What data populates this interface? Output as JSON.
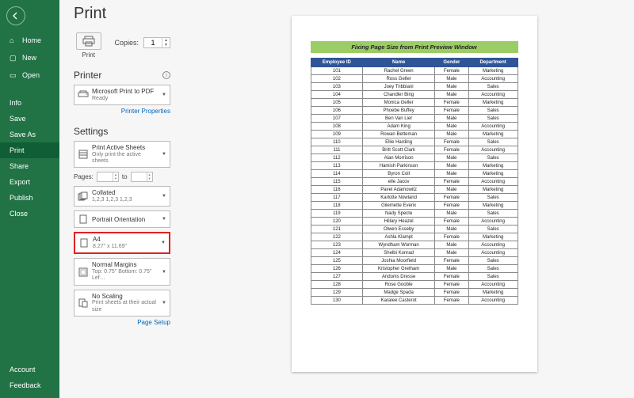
{
  "sidebar": {
    "items": [
      "Home",
      "New",
      "Open"
    ],
    "menu": [
      "Info",
      "Save",
      "Save As",
      "Print",
      "Share",
      "Export",
      "Publish",
      "Close"
    ],
    "selected": "Print",
    "footer": [
      "Account",
      "Feedback"
    ]
  },
  "header": {
    "title": "Print"
  },
  "print_button": {
    "label": "Print"
  },
  "copies": {
    "label": "Copies:",
    "value": "1"
  },
  "printer_section": {
    "title": "Printer"
  },
  "printer_combo": {
    "name": "Microsoft Print to PDF",
    "status": "Ready"
  },
  "printer_props_link": "Printer Properties",
  "settings_section": {
    "title": "Settings"
  },
  "sheets_combo": {
    "title": "Print Active Sheets",
    "sub": "Only print the active sheets"
  },
  "pages": {
    "label": "Pages:",
    "to": "to",
    "from": "",
    "end": ""
  },
  "collate_combo": {
    "title": "Collated",
    "sub": "1,2,3   1,2,3   1,2,3"
  },
  "orient_combo": {
    "title": "Portrait Orientation",
    "sub": ""
  },
  "size_combo": {
    "title": "A4",
    "sub": "8.27\" x 11.69\""
  },
  "margins_combo": {
    "title": "Normal Margins",
    "sub": "Top: 0.75\" Bottom: 0.75\" Lef…"
  },
  "scaling_combo": {
    "title": "No Scaling",
    "sub": "Print sheets at their actual size"
  },
  "page_setup_link": "Page Setup",
  "doc": {
    "title": "Fixing Page Size from Print Preview Window",
    "headers": [
      "Employee ID",
      "Name",
      "Gender",
      "Department"
    ]
  },
  "chart_data": {
    "type": "table",
    "columns": [
      "Employee ID",
      "Name",
      "Gender",
      "Department"
    ],
    "rows": [
      [
        "101",
        "Rachel Green",
        "Female",
        "Marketing"
      ],
      [
        "102",
        "Ross Geller",
        "Male",
        "Accounting"
      ],
      [
        "103",
        "Joey Tribbiani",
        "Male",
        "Sales"
      ],
      [
        "104",
        "Chandler Bing",
        "Male",
        "Accounting"
      ],
      [
        "105",
        "Monica Geller",
        "Female",
        "Marketing"
      ],
      [
        "106",
        "Phoebe Buffey",
        "Female",
        "Sales"
      ],
      [
        "107",
        "Ben Van Lier",
        "Male",
        "Sales"
      ],
      [
        "108",
        "Adam King",
        "Male",
        "Accounting"
      ],
      [
        "109",
        "Rowan Betteman",
        "Male",
        "Marketing"
      ],
      [
        "110",
        "Ellie Harding",
        "Female",
        "Sales"
      ],
      [
        "111",
        "Britt Scott Clark",
        "Female",
        "Accounting"
      ],
      [
        "112",
        "Alan Morrison",
        "Male",
        "Sales"
      ],
      [
        "113",
        "Hamish Parkinson",
        "Male",
        "Marketing"
      ],
      [
        "114",
        "Byron Coll",
        "Male",
        "Marketing"
      ],
      [
        "115",
        "elle Jacov",
        "Female",
        "Accounting"
      ],
      [
        "116",
        "Pavel Adamowitz",
        "Male",
        "Marketing"
      ],
      [
        "117",
        "Karlotte Nowland",
        "Female",
        "Sales"
      ],
      [
        "118",
        "Gilemette Everix",
        "Female",
        "Marketing"
      ],
      [
        "119",
        "Nady Specte",
        "Male",
        "Sales"
      ],
      [
        "120",
        "Hillary Heazel",
        "Female",
        "Accounting"
      ],
      [
        "121",
        "Olwen Esseby",
        "Male",
        "Sales"
      ],
      [
        "122",
        "Ashla Klampt",
        "Female",
        "Marketing"
      ],
      [
        "123",
        "Wyndham Worman",
        "Male",
        "Accounting"
      ],
      [
        "124",
        "Shelbi Konrad",
        "Male",
        "Accounting"
      ],
      [
        "125",
        "Joshia Moorfield",
        "Female",
        "Sales"
      ],
      [
        "126",
        "Kristopher Gretham",
        "Male",
        "Sales"
      ],
      [
        "127",
        "Andonis Dresse",
        "Female",
        "Sales"
      ],
      [
        "128",
        "Rose Gooble",
        "Female",
        "Accounting"
      ],
      [
        "129",
        "Madge Spada",
        "Female",
        "Marketing"
      ],
      [
        "130",
        "Karalee Casterot",
        "Female",
        "Accounting"
      ]
    ]
  }
}
